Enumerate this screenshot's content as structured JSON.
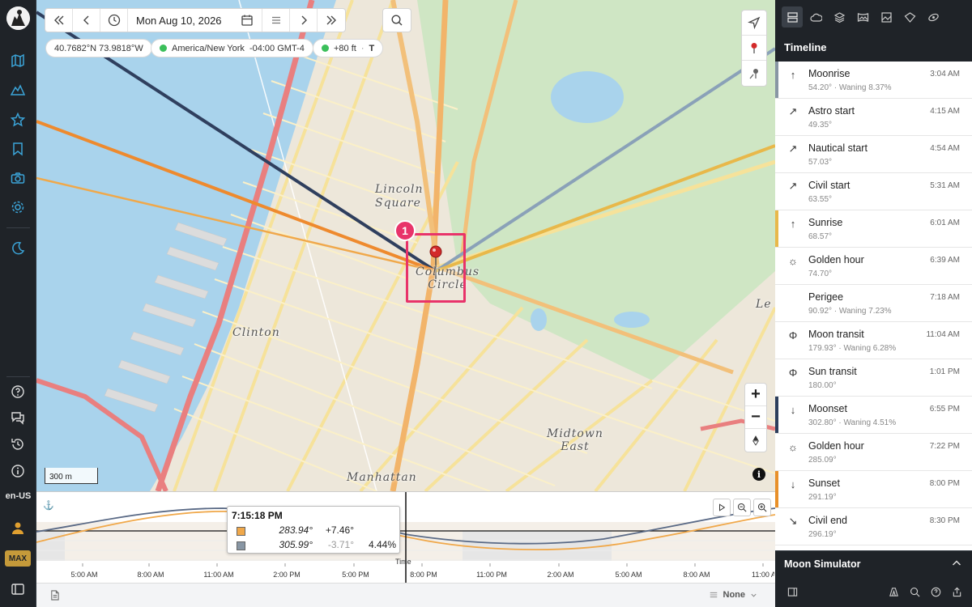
{
  "sidebar": {
    "language": "en-US",
    "badge": "MAX"
  },
  "toolbar": {
    "date": "Mon Aug 10, 2026"
  },
  "status_pills": {
    "coordinates": "40.7682°N 73.9818°W",
    "timezone": "America/New York  -04:00 GMT-4",
    "elevation": "+80 ft",
    "elevation_suffix": "T"
  },
  "map": {
    "places": {
      "lincoln_square": "Lincoln Square",
      "columbus_circle_line1": "Columbus",
      "columbus_circle_line2": "Circle",
      "clinton": "Clinton",
      "midtown_east_line1": "Midtown",
      "midtown_east_line2": "East",
      "manhattan": "Manhattan",
      "lenox_hill": "Le"
    },
    "scale_label": "300 m",
    "marker_badge": "1",
    "info_glyph": "i"
  },
  "timeline_chart": {
    "tooltip": {
      "time": "7:15:18 PM",
      "rows": [
        {
          "color": "#f0a84a",
          "azimuth": "283.94°",
          "altitude": "+7.46°",
          "extra": ""
        },
        {
          "color": "#8896a4",
          "azimuth": "305.99°",
          "altitude": "-3.71°",
          "extra": "4.44%"
        }
      ]
    },
    "cursor_label": "Time",
    "axis_ticks": [
      "5:00 AM",
      "8:00 AM",
      "11:00 AM",
      "2:00 PM",
      "5:00 PM",
      "8:00 PM",
      "11:00 PM",
      "2:00 AM",
      "5:00 AM",
      "8:00 AM",
      "11:00 A"
    ]
  },
  "bottombar": {
    "dropdown_value": "None"
  },
  "right_panel": {
    "title": "Timeline",
    "events": [
      {
        "name": "Moonrise",
        "detail": "54.20° · Waning 8.37%",
        "time": "3:04 AM",
        "icon": "↑",
        "accent": "#8896a4"
      },
      {
        "name": "Astro start",
        "detail": "49.35°",
        "time": "4:15 AM",
        "icon": "↗",
        "accent": ""
      },
      {
        "name": "Nautical start",
        "detail": "57.03°",
        "time": "4:54 AM",
        "icon": "↗",
        "accent": ""
      },
      {
        "name": "Civil start",
        "detail": "63.55°",
        "time": "5:31 AM",
        "icon": "↗",
        "accent": ""
      },
      {
        "name": "Sunrise",
        "detail": "68.57°",
        "time": "6:01 AM",
        "icon": "↑",
        "accent": "#e8b84a"
      },
      {
        "name": "Golden hour",
        "detail": "74.70°",
        "time": "6:39 AM",
        "icon": "☼",
        "accent": ""
      },
      {
        "name": "Perigee",
        "detail": "90.92° · Waning 7.23%",
        "time": "7:18 AM",
        "icon": "",
        "accent": ""
      },
      {
        "name": "Moon transit",
        "detail": "179.93° · Waning 6.28%",
        "time": "11:04 AM",
        "icon": "Φ",
        "accent": ""
      },
      {
        "name": "Sun transit",
        "detail": "180.00°",
        "time": "1:01 PM",
        "icon": "Φ",
        "accent": ""
      },
      {
        "name": "Moonset",
        "detail": "302.80° · Waning 4.51%",
        "time": "6:55 PM",
        "icon": "↓",
        "accent": "#2c3e5c"
      },
      {
        "name": "Golden hour",
        "detail": "285.09°",
        "time": "7:22 PM",
        "icon": "☼",
        "accent": ""
      },
      {
        "name": "Sunset",
        "detail": "291.19°",
        "time": "8:00 PM",
        "icon": "↓",
        "accent": "#e8902a"
      },
      {
        "name": "Civil end",
        "detail": "296.19°",
        "time": "8:30 PM",
        "icon": "↘",
        "accent": ""
      }
    ],
    "moon_simulator": "Moon Simulator"
  },
  "colors": {
    "highlight": "#e8336a",
    "sun": "#f0a84a",
    "moon": "#8896a4"
  }
}
